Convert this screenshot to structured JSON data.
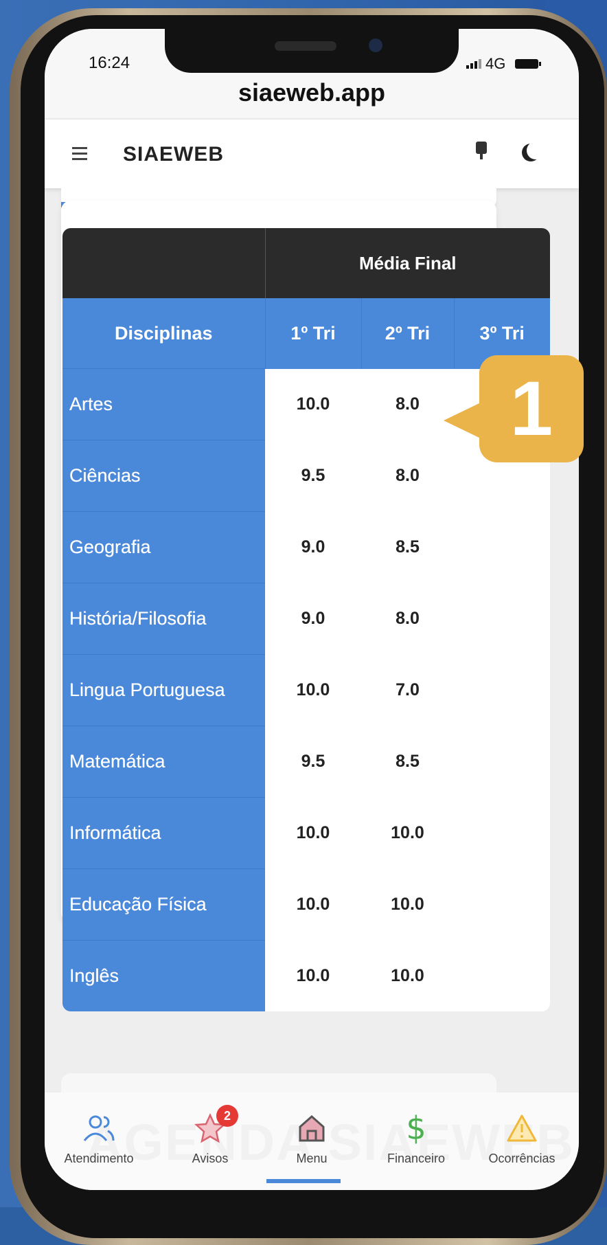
{
  "status": {
    "time": "16:24",
    "network": "4G"
  },
  "browser": {
    "url": "siaeweb.app"
  },
  "appbar": {
    "brand": "SIAEWEB"
  },
  "table": {
    "group_header": "Média Final",
    "columns": [
      "Disciplinas",
      "1º Tri",
      "2º Tri",
      "3º Tri"
    ],
    "rows": [
      {
        "name": "Artes",
        "t1": "10.0",
        "t2": "8.0",
        "t3": ""
      },
      {
        "name": "Ciências",
        "t1": "9.5",
        "t2": "8.0",
        "t3": ""
      },
      {
        "name": "Geografia",
        "t1": "9.0",
        "t2": "8.5",
        "t3": ""
      },
      {
        "name": "História/Filosofia",
        "t1": "9.0",
        "t2": "8.0",
        "t3": ""
      },
      {
        "name": "Lingua Portuguesa",
        "t1": "10.0",
        "t2": "7.0",
        "t3": ""
      },
      {
        "name": "Matemática",
        "t1": "9.5",
        "t2": "8.5",
        "t3": ""
      },
      {
        "name": "Informática",
        "t1": "10.0",
        "t2": "10.0",
        "t3": ""
      },
      {
        "name": "Educação Física",
        "t1": "10.0",
        "t2": "10.0",
        "t3": ""
      },
      {
        "name": "Inglês",
        "t1": "10.0",
        "t2": "10.0",
        "t3": ""
      }
    ]
  },
  "callout": {
    "number": "1"
  },
  "watermark": "AGENDA SIAEWEB",
  "bottom_nav": {
    "items": [
      {
        "label": "Atendimento",
        "icon": "users-icon"
      },
      {
        "label": "Avisos",
        "icon": "star-icon",
        "badge": "2"
      },
      {
        "label": "Menu",
        "icon": "home-icon"
      },
      {
        "label": "Financeiro",
        "icon": "dollar-icon"
      },
      {
        "label": "Ocorrências",
        "icon": "warning-icon"
      }
    ]
  },
  "colors": {
    "accent": "#4a88d9",
    "header_dark": "#2b2b2b",
    "callout": "#eab44a",
    "badge": "#e53935"
  }
}
